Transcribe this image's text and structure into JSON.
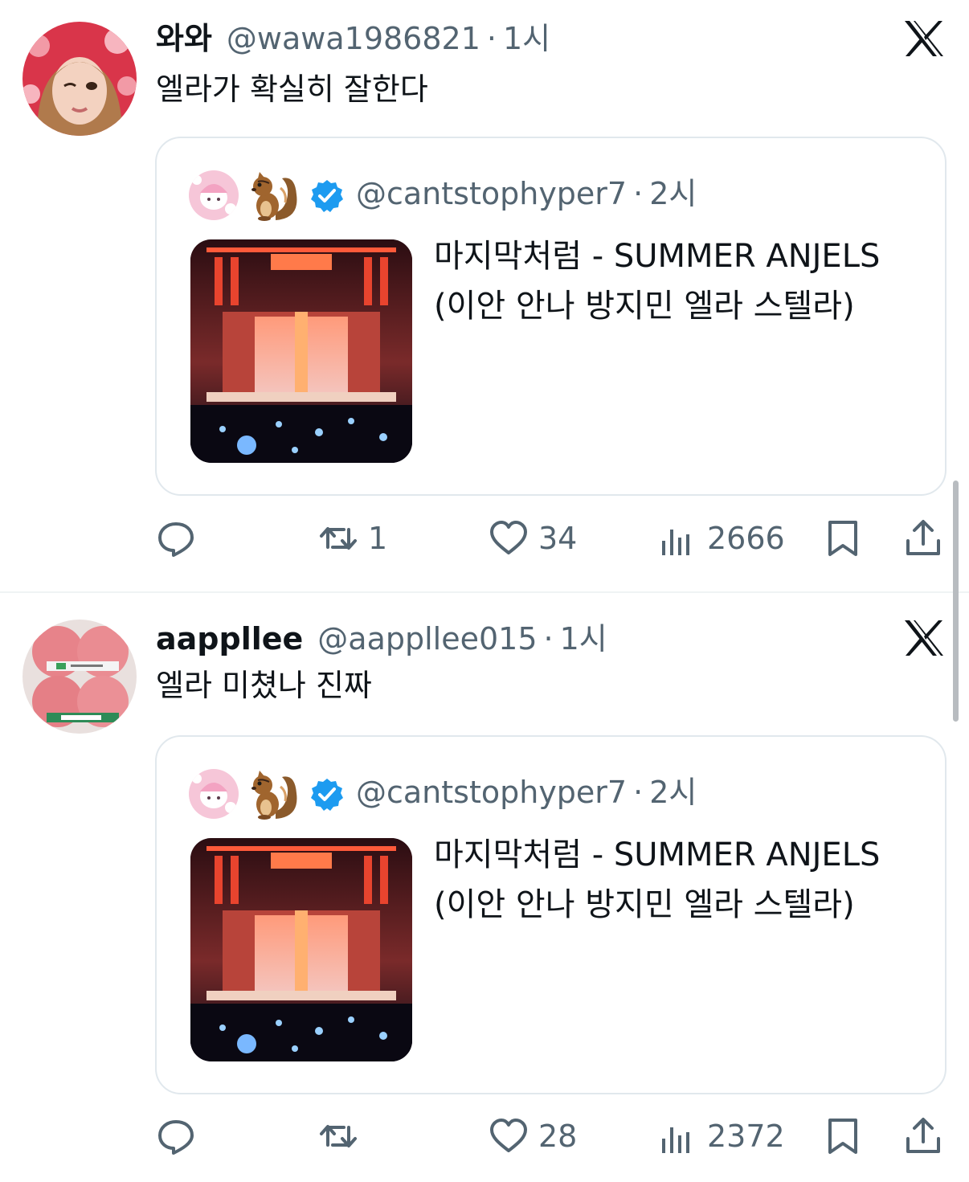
{
  "tweets": [
    {
      "display_name": "와와",
      "handle": "@wawa1986821",
      "time": "1시",
      "text": "엘라가 확실히 잘한다",
      "quote": {
        "emoji": "🐿️",
        "handle": "@cantstophyper7",
        "time": "2시",
        "text": "마지막처럼 - SUMMER ANJELS (이안 안나 방지민 엘라 스텔라)"
      },
      "actions": {
        "replies": "",
        "retweets": "1",
        "likes": "34",
        "views": "2666"
      }
    },
    {
      "display_name": "aappllee",
      "handle": "@aappllee015",
      "time": "1시",
      "text": "엘라 미쳤나 진짜",
      "quote": {
        "emoji": "🐿️",
        "handle": "@cantstophyper7",
        "time": "2시",
        "text": "마지막처럼 - SUMMER ANJELS (이안 안나 방지민 엘라 스텔라)"
      },
      "actions": {
        "replies": "",
        "retweets": "",
        "likes": "28",
        "views": "2372"
      }
    }
  ],
  "separator": "·",
  "colors": {
    "text": "#0f1419",
    "secondary": "#536471",
    "verified": "#1d9bf0",
    "border": "#e1e8ed"
  }
}
